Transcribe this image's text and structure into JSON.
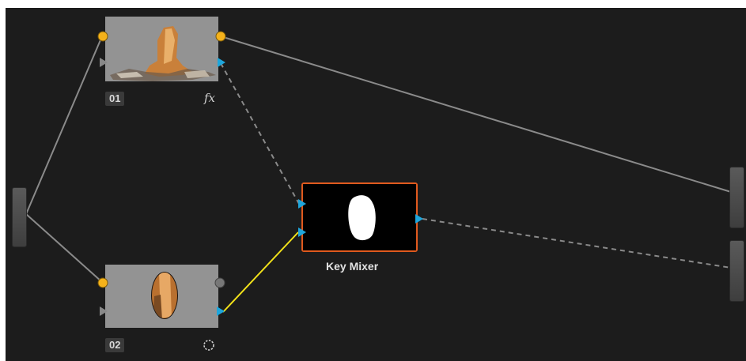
{
  "nodes": {
    "node_01": {
      "label": "01",
      "effect_icon": "fx-icon",
      "effect_label": "fx"
    },
    "node_02": {
      "label": "02",
      "effect_icon": "circle-mask-icon"
    },
    "key_mixer": {
      "label": "Key Mixer"
    }
  },
  "colors": {
    "canvas_bg": "#1c1c1c",
    "node_body": "#8e8e8e",
    "rgb_input_port": "#f5b21b",
    "key_port": "#1ea6dc",
    "selected_border": "#e05a1e",
    "selected_wire": "#f2e21a",
    "wire": "#8a8a8a",
    "unused_port": "#777777"
  }
}
